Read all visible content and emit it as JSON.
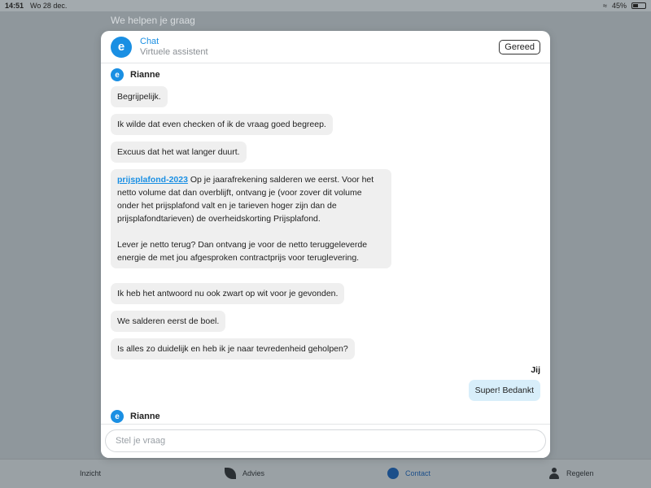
{
  "status": {
    "time": "14:51",
    "date": "Wo 28 dec.",
    "battery": "45%",
    "battery_level": 0.45
  },
  "background": {
    "title": "We helpen je graag"
  },
  "tabs": [
    {
      "label": "Inzicht",
      "icon": "grid-icon"
    },
    {
      "label": "Advies",
      "icon": "leaf-icon"
    },
    {
      "label": "Contact",
      "icon": "chat-icon",
      "active": true
    },
    {
      "label": "Regelen",
      "icon": "person-icon"
    }
  ],
  "header": {
    "logo": "e",
    "title": "Chat",
    "subtitle": "Virtuele assistent",
    "done_label": "Gereed"
  },
  "messages": {
    "sender": "Rianne",
    "m1": "Begrijpelijk.",
    "m2": "Ik wilde dat even checken of ik de vraag goed begreep.",
    "m3": "Excuus dat het wat langer duurt.",
    "m4_link": "prijsplafond-2023",
    "m4_p1": " Op je jaarafrekening salderen we eerst. Voor het netto volume dat dan overblijft, ontvang je (voor zover dit volume onder het prijsplafond valt en je tarieven hoger zijn dan de prijsplafondtarieven) de overheidskorting Prijsplafond.",
    "m4_p2": "Lever je netto terug? Dan ontvang je voor de netto teruggeleverde energie de met jou afgesproken contractprijs voor teruglevering.",
    "m5": "Ik heb het antwoord nu ook zwart op wit voor je gevonden.",
    "m6": "We salderen eerst de boel.",
    "m7": "Is alles zo duidelijk en heb ik je naar tevredenheid geholpen?",
    "me_label": "Jij",
    "me_text": "Super! Bedankt",
    "sender2": "Rianne"
  },
  "input": {
    "placeholder": "Stel je vraag"
  },
  "colors": {
    "accent": "#1a8fe3",
    "bubble": "#efefef",
    "my_bubble": "#d8eefa"
  }
}
